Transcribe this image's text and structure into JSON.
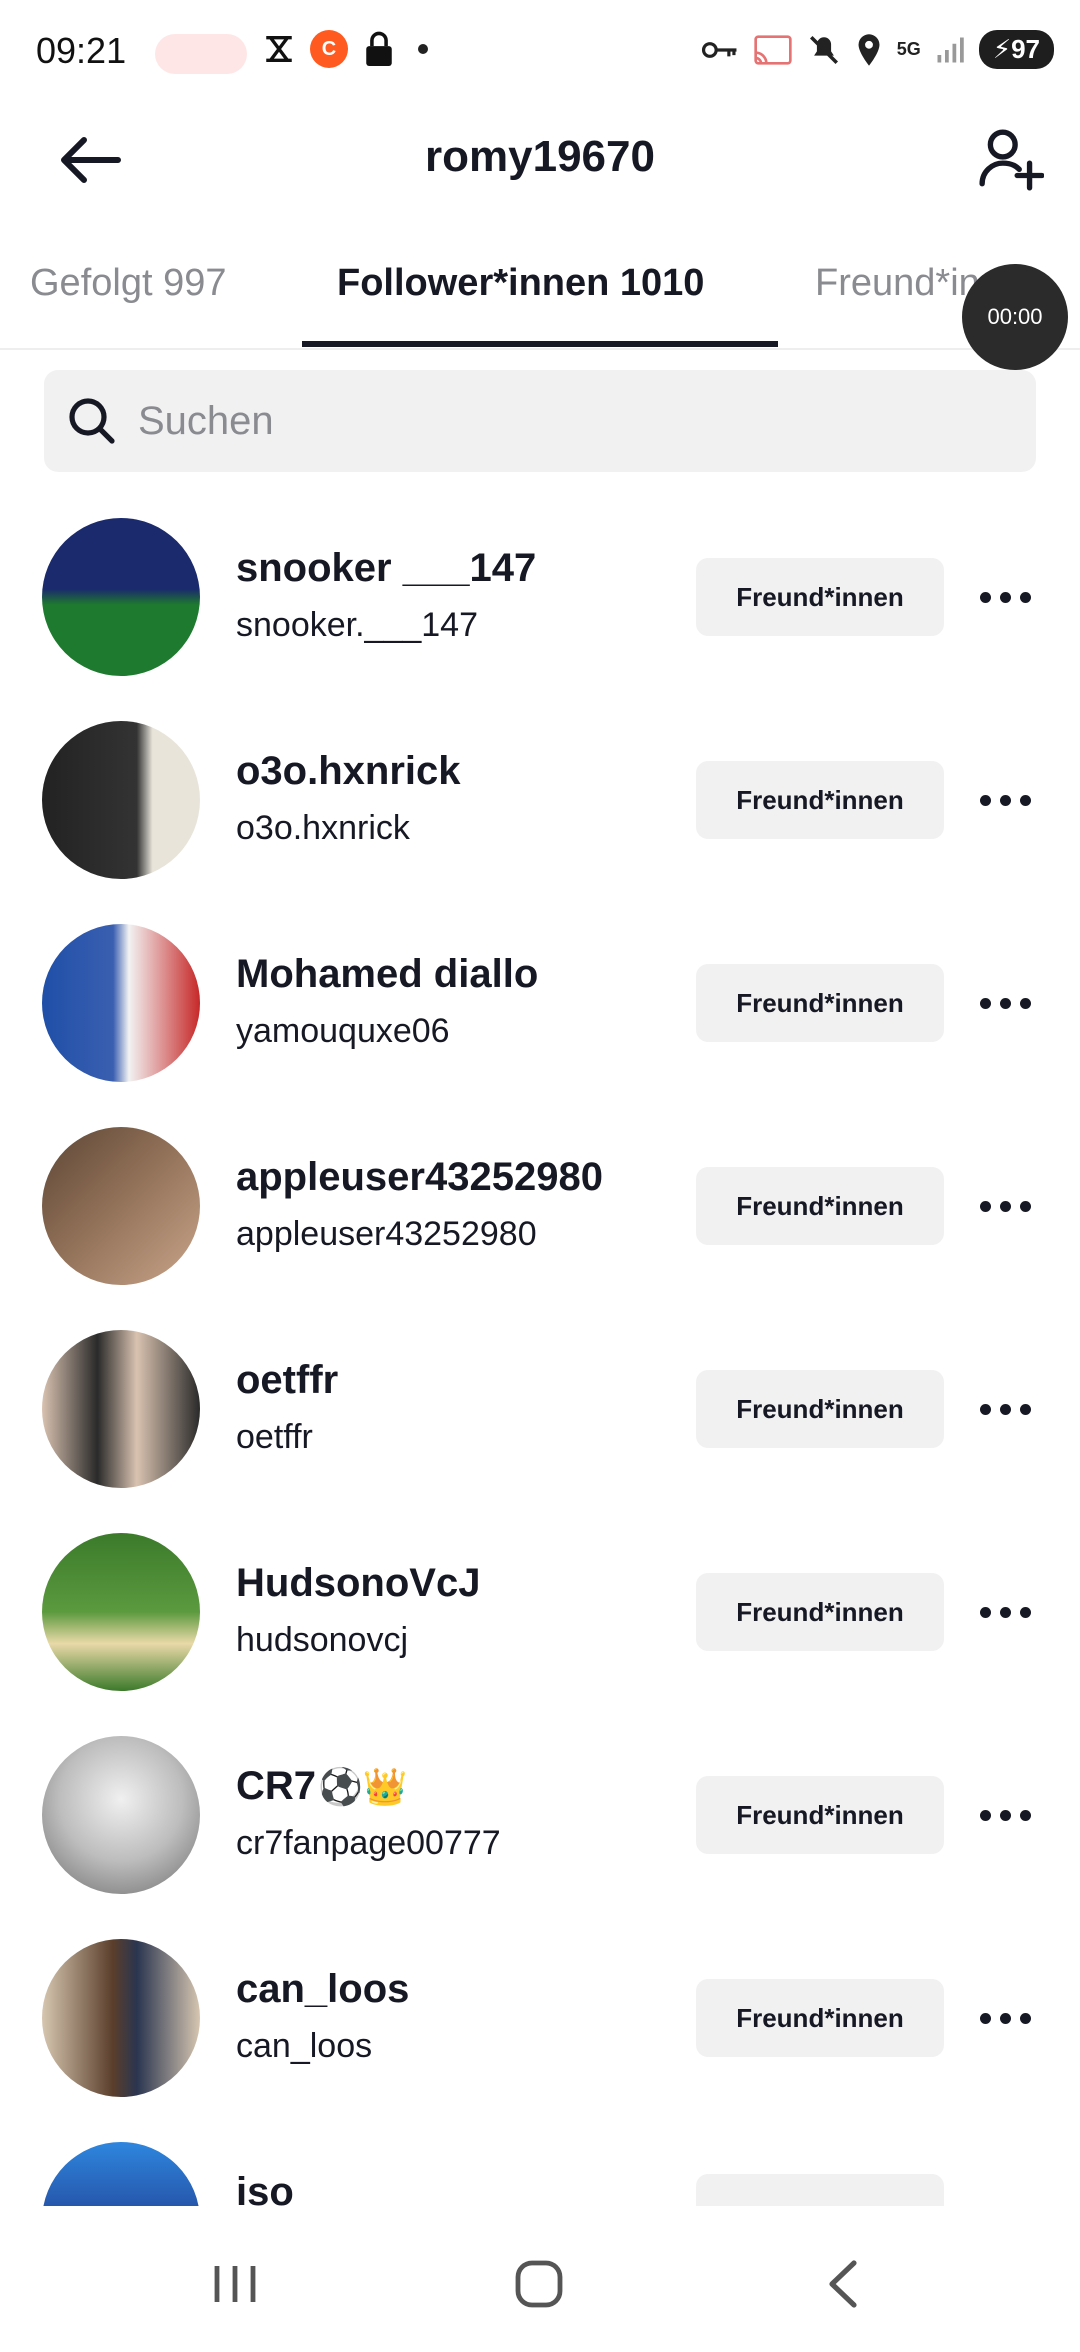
{
  "status_bar": {
    "time": "09:21",
    "network": "5G",
    "battery": "97",
    "icons": [
      "x-close-icon",
      "capcut-icon",
      "lock-icon",
      "key-icon",
      "cast-icon",
      "mute-icon",
      "location-icon",
      "signal-icon",
      "battery-icon"
    ]
  },
  "header": {
    "title": "romy19670",
    "back_icon": "arrow-left-icon",
    "add_icon": "add-user-icon"
  },
  "tabs": [
    {
      "label": "Gefolgt 997",
      "active": false
    },
    {
      "label": "Follower*innen 1010",
      "active": true
    },
    {
      "label": "Freund*innen",
      "active": false
    }
  ],
  "overlay": {
    "timer": "00:00"
  },
  "search": {
    "placeholder": "Suchen"
  },
  "followers": [
    {
      "display_name": "snooker ___147",
      "username": "snooker.___147",
      "button": "Freund*innen",
      "avatar_colors": [
        "#1a2a6c",
        "#1e7a2e"
      ]
    },
    {
      "display_name": "o3o.hxnrick",
      "username": "o3o.hxnrick",
      "button": "Freund*innen",
      "avatar_colors": [
        "#222222",
        "#e8e4da"
      ]
    },
    {
      "display_name": "Mohamed diallo",
      "username": "yamouquxe06",
      "button": "Freund*innen",
      "avatar_colors": [
        "#1f4fa8",
        "#c62828"
      ]
    },
    {
      "display_name": "appleuser43252980",
      "username": "appleuser43252980",
      "button": "Freund*innen",
      "avatar_colors": [
        "#5b4636",
        "#c9a58a"
      ]
    },
    {
      "display_name": "oetffr",
      "username": "oetffr",
      "button": "Freund*innen",
      "avatar_colors": [
        "#2a2a2a",
        "#d9c2b0"
      ]
    },
    {
      "display_name": "HudsonoVcJ",
      "username": "hudsonovcj",
      "button": "Freund*innen",
      "avatar_colors": [
        "#3b7a2a",
        "#e9d9a8"
      ]
    },
    {
      "display_name": "CR7",
      "emoji": "⚽👑",
      "username": "cr7fanpage00777",
      "button": "Freund*innen",
      "avatar_colors": [
        "#6b6b6b",
        "#f0f0f0"
      ]
    },
    {
      "display_name": "can_loos",
      "username": "can_loos",
      "button": "Freund*innen",
      "avatar_colors": [
        "#5a3e2b",
        "#d6c6b0"
      ]
    },
    {
      "display_name": "iso",
      "username": "",
      "button": "",
      "avatar_colors": [
        "#1b1464",
        "#2e86de"
      ]
    }
  ],
  "nav_bar": {
    "icons": [
      "recent-apps-icon",
      "home-icon",
      "back-icon"
    ]
  }
}
